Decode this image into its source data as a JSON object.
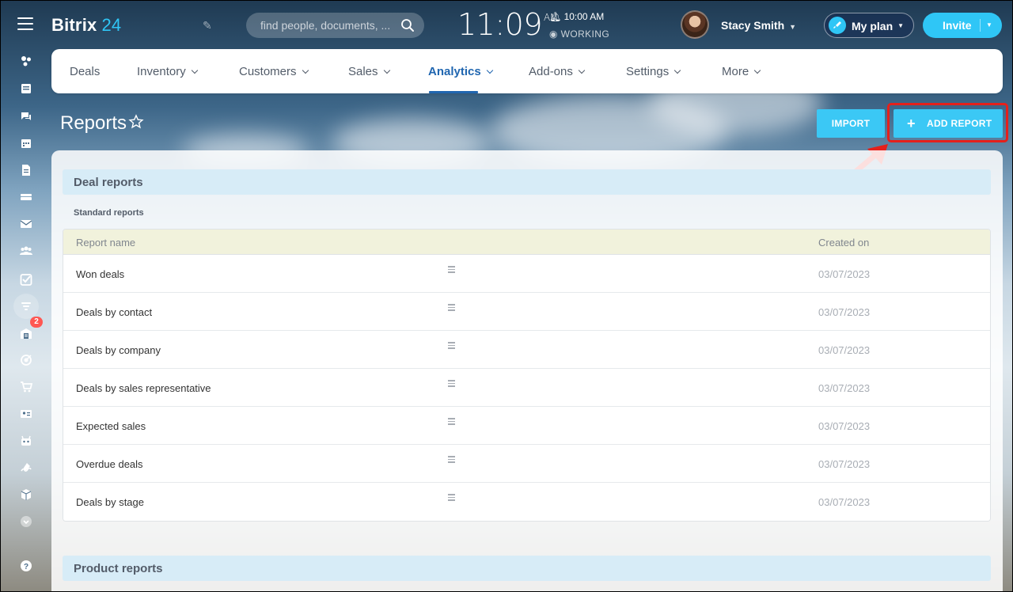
{
  "app": {
    "logo_name": "Bitrix",
    "logo_num": "24"
  },
  "topbar": {
    "search_placeholder": "find people, documents, ...",
    "clock_time": "11:09",
    "clock_ampm": "AM",
    "alarm": "10:00 AM",
    "status": "WORKING",
    "user_name": "Stacy Smith",
    "plan_label": "My plan",
    "invite_label": "Invite"
  },
  "nav": {
    "items": [
      {
        "label": "Deals",
        "dropdown": false
      },
      {
        "label": "Inventory",
        "dropdown": true
      },
      {
        "label": "Customers",
        "dropdown": true
      },
      {
        "label": "Sales",
        "dropdown": true
      },
      {
        "label": "Analytics",
        "dropdown": true,
        "active": true
      },
      {
        "label": "Add-ons",
        "dropdown": true
      },
      {
        "label": "Settings",
        "dropdown": true
      },
      {
        "label": "More",
        "dropdown": true
      }
    ]
  },
  "page": {
    "title": "Reports",
    "import_label": "IMPORT",
    "add_report_label": "ADD REPORT"
  },
  "sidebar": {
    "tasks_badge": "2"
  },
  "deal_reports": {
    "heading": "Deal reports",
    "subheading": "Standard reports",
    "columns": {
      "name": "Report name",
      "created": "Created on"
    },
    "rows": [
      {
        "name": "Won deals",
        "created": "03/07/2023"
      },
      {
        "name": "Deals by contact",
        "created": "03/07/2023"
      },
      {
        "name": "Deals by company",
        "created": "03/07/2023"
      },
      {
        "name": "Deals by sales representative",
        "created": "03/07/2023"
      },
      {
        "name": "Expected sales",
        "created": "03/07/2023"
      },
      {
        "name": "Overdue deals",
        "created": "03/07/2023"
      },
      {
        "name": "Deals by stage",
        "created": "03/07/2023"
      }
    ]
  },
  "product_reports": {
    "heading": "Product reports"
  },
  "colors": {
    "accent": "#2fc6f6",
    "button": "#3bc8f5",
    "nav_active": "#2066b0",
    "highlight": "#e5201b",
    "section_head": "#d7ecf7",
    "table_head": "#f1f2dc"
  }
}
